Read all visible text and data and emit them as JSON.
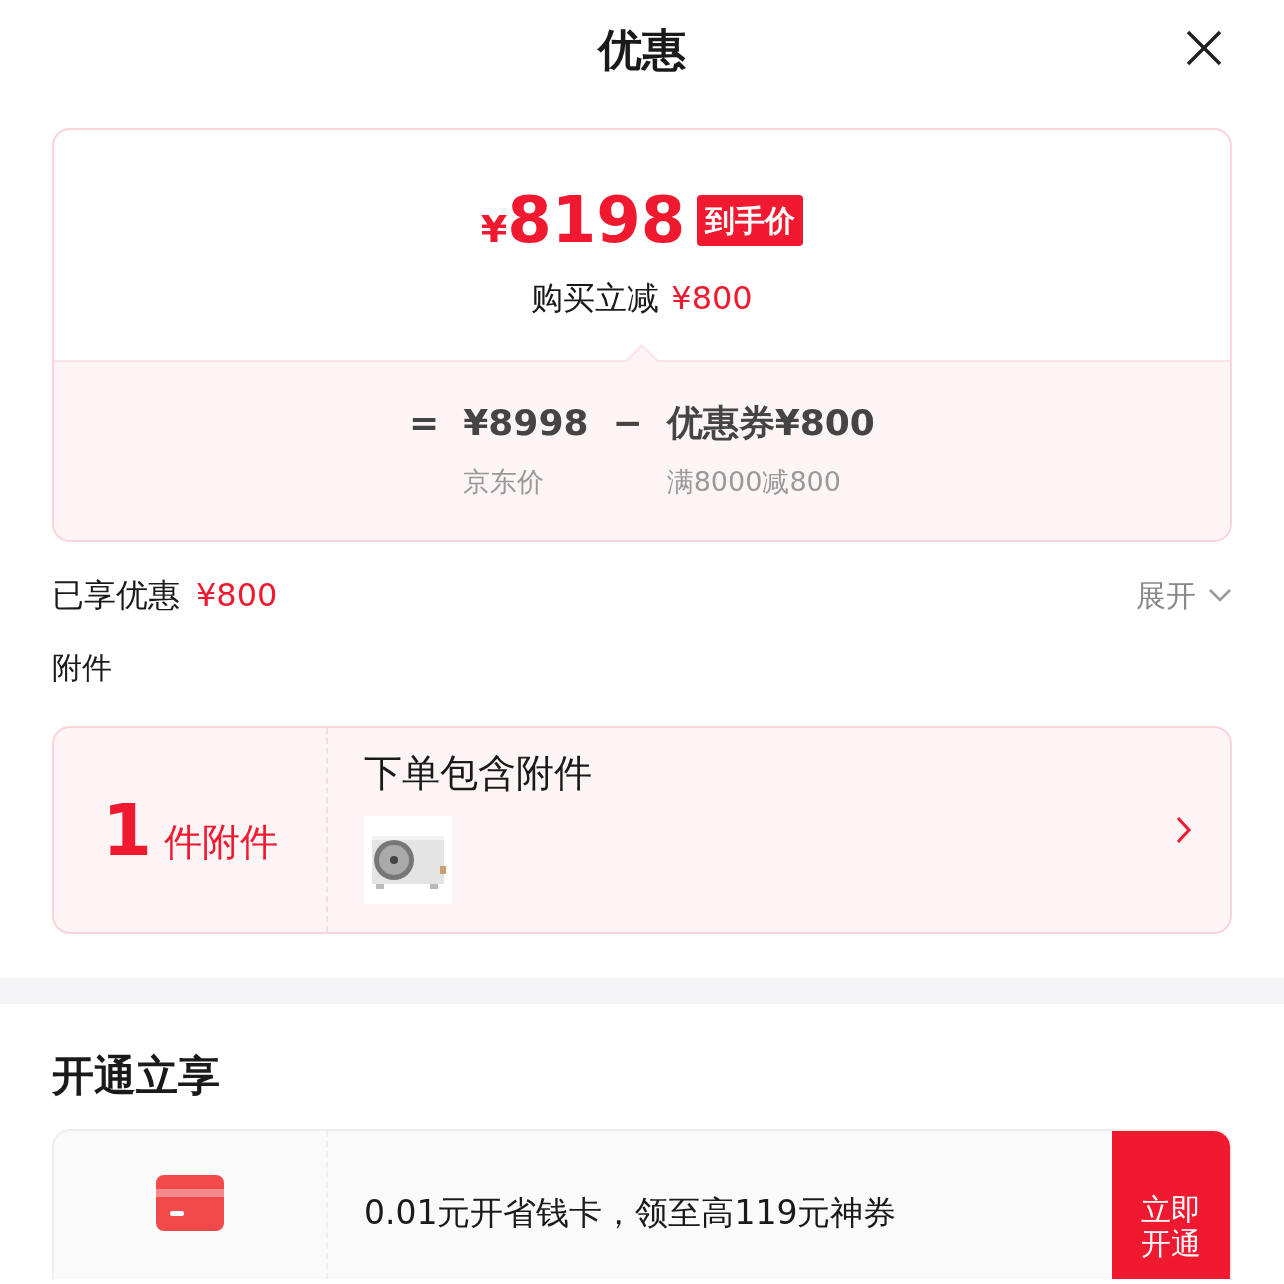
{
  "header": {
    "title": "优惠"
  },
  "price_card": {
    "final_price_symbol": "¥",
    "final_price": "8198",
    "final_price_badge": "到手价",
    "instant_discount_label": "购买立减",
    "instant_discount_value": "¥800",
    "formula": {
      "equals": "=",
      "base_price": "¥8998",
      "minus": "−",
      "coupon": "优惠券¥800",
      "base_price_caption": "京东价",
      "coupon_caption": "满8000减800"
    }
  },
  "discount_summary": {
    "label": "已享优惠",
    "value": "¥800",
    "expand": "展开",
    "expanded": false
  },
  "accessories": {
    "heading": "附件",
    "count": "1",
    "count_unit": "件附件",
    "title": "下单包含附件"
  },
  "membership": {
    "heading": "开通立享",
    "offer": "0.01元开省钱卡，领至高119元神券",
    "button": "立即开通"
  }
}
